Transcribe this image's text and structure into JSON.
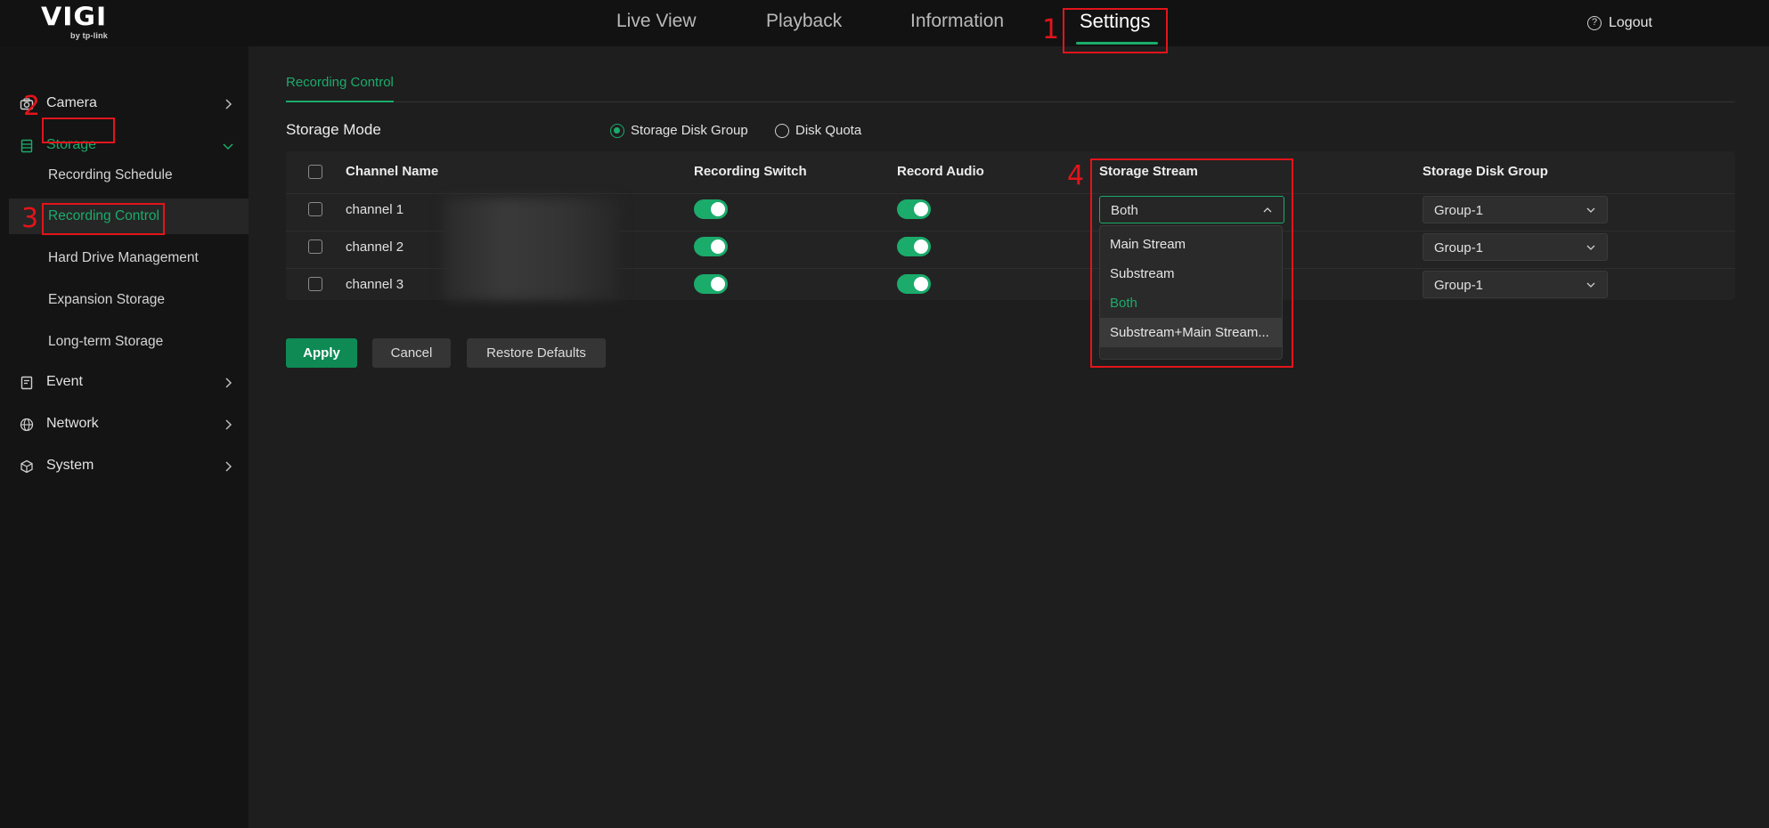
{
  "brand": {
    "logo": "VIGI",
    "sub": "by tp-link"
  },
  "topnav": {
    "items": [
      "Live View",
      "Playback",
      "Information",
      "Settings"
    ],
    "active": "Settings",
    "logout_label": "Logout"
  },
  "sidebar": {
    "camera": "Camera",
    "storage": "Storage",
    "storage_items": [
      "Recording Schedule",
      "Recording Control",
      "Hard Drive Management",
      "Expansion Storage",
      "Long-term Storage"
    ],
    "event": "Event",
    "network": "Network",
    "system": "System"
  },
  "page": {
    "tab": "Recording Control",
    "storage_mode_label": "Storage Mode",
    "radio_group": "Storage Disk Group",
    "radio_quota": "Disk Quota"
  },
  "table": {
    "headers": [
      "Channel Name",
      "Recording Switch",
      "Record Audio",
      "Storage Stream",
      "Storage Disk Group"
    ],
    "rows": [
      {
        "name": "channel 1",
        "stream": "Both",
        "group": "Group-1"
      },
      {
        "name": "channel 2",
        "stream": "",
        "group": "Group-1"
      },
      {
        "name": "channel 3",
        "stream": "",
        "group": "Group-1"
      }
    ]
  },
  "stream_options": [
    "Main Stream",
    "Substream",
    "Both",
    "Substream+Main Stream..."
  ],
  "buttons": {
    "apply": "Apply",
    "cancel": "Cancel",
    "restore": "Restore Defaults"
  },
  "annotations": [
    "1",
    "2",
    "3",
    "4"
  ],
  "colors": {
    "accent": "#1bab6b",
    "annotation": "#e3141b"
  }
}
